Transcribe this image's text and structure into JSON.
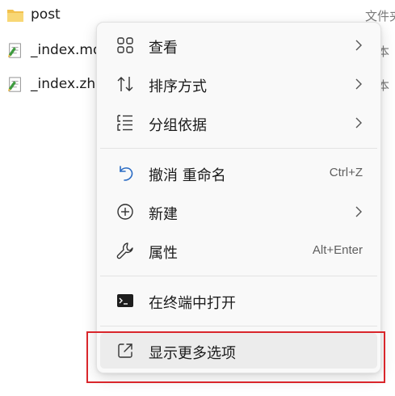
{
  "files": [
    {
      "name": "post",
      "icon": "folder-icon",
      "type": "文件夹"
    },
    {
      "name": "_index.md",
      "icon": "text-file-icon",
      "type": "文本"
    },
    {
      "name": "_index.zh",
      "icon": "text-file-icon",
      "type": "文本"
    }
  ],
  "menu": {
    "items": [
      {
        "label": "查看",
        "icon": "view-grid-icon",
        "submenu": true
      },
      {
        "label": "排序方式",
        "icon": "sort-icon",
        "submenu": true
      },
      {
        "label": "分组依据",
        "icon": "group-by-icon",
        "submenu": true
      },
      {
        "label": "撤消 重命名",
        "icon": "undo-icon",
        "shortcut": "Ctrl+Z"
      },
      {
        "label": "新建",
        "icon": "new-plus-icon",
        "submenu": true
      },
      {
        "label": "属性",
        "icon": "wrench-icon",
        "shortcut": "Alt+Enter"
      },
      {
        "label": "在终端中打开",
        "icon": "terminal-icon"
      },
      {
        "label": "显示更多选项",
        "icon": "show-more-options-icon",
        "hovered": true
      }
    ]
  },
  "colors": {
    "highlight": "#d9262b",
    "menu_bg": "#f9f9f9",
    "hover_bg": "#ececec"
  }
}
